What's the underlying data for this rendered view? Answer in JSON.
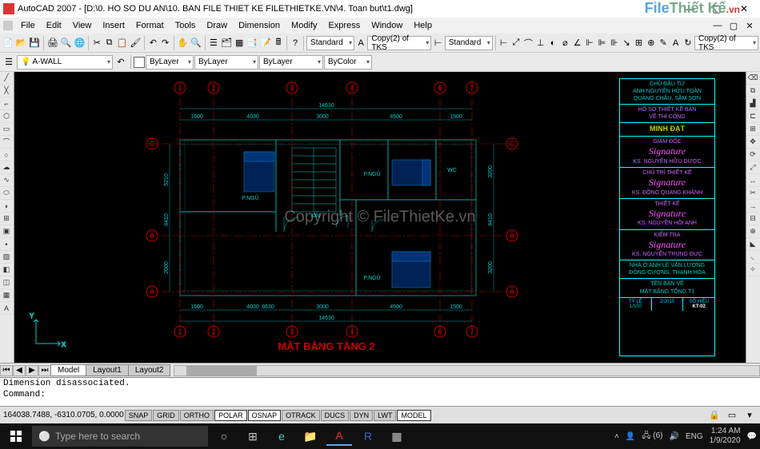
{
  "titlebar": {
    "title": "AutoCAD 2007 - [D:\\0. HO SO DU AN\\10. BAN FILE THIET KE FILETHIETKE.VN\\4. Toan but\\t1.dwg]"
  },
  "menubar": {
    "items": [
      "File",
      "Edit",
      "View",
      "Insert",
      "Format",
      "Tools",
      "Draw",
      "Dimension",
      "Modify",
      "Express",
      "Window",
      "Help"
    ]
  },
  "toolbar1": {
    "layer": "A-WALL",
    "linetype": "ByLayer",
    "lineweight": "ByLayer",
    "colorlabel": "ByColor"
  },
  "toolbar2": {
    "dd1": "Standard",
    "dd2": "Copy(2) of TKS",
    "dd3": "Standard",
    "dd4": "Copy(2) of TKS"
  },
  "tabs": {
    "model": "Model",
    "layout1": "Layout1",
    "layout2": "Layout2"
  },
  "command": {
    "line1": "Dimension disassociated.",
    "line2": "Command:"
  },
  "statusbar": {
    "coords": "164038.7488, -6310.0705, 0.0000",
    "toggles": [
      "SNAP",
      "GRID",
      "ORTHO",
      "POLAR",
      "OSNAP",
      "OTRACK",
      "DUCS",
      "DYN",
      "LWT",
      "MODEL"
    ]
  },
  "taskbar": {
    "search_placeholder": "Type here to search",
    "time": "1:24 AM",
    "date": "1/9/2020",
    "lang": "ENG",
    "net": "(6)"
  },
  "drawing": {
    "title": "MẶT BẰNG TẦNG 2",
    "grid_letters": [
      "A",
      "B",
      "C"
    ],
    "grid_numbers": [
      "1",
      "2",
      "3",
      "4",
      "6",
      "7"
    ],
    "dims_top_total": "14630",
    "dims_top": [
      "1600",
      "4030",
      "3000",
      "4500",
      "1500"
    ],
    "dims_bot_total": "14630",
    "dims_bot": [
      "1600",
      "4030",
      "3000",
      "4500",
      "1500"
    ],
    "dims_bot2": "8630",
    "dims_left": [
      "5210",
      "8410",
      "2000"
    ],
    "dims_right": [
      "3200",
      "8410",
      "3200"
    ],
    "rooms": {
      "pngu1": "P.NGỦ",
      "pngu2": "P.NGỦ",
      "pngu3": "P.NGỦ",
      "wc": "WC",
      "dn": "DN"
    }
  },
  "titleblock": {
    "owner_title": "CHỦ ĐẦU TƯ",
    "owner1": "ANH NGUYỄN HỮU TOÀN",
    "owner2": "QUẢNG CHÂU, SẦM SƠN",
    "doc_title1": "HỒ SƠ THIẾT KẾ BẢN",
    "doc_title2": "VẼ THI CÔNG",
    "company": "MINH ĐẠT",
    "role1": "GIÁM ĐỐC",
    "name1": "KS. NGUYỄN HỮU DƯỢC",
    "role2": "CHỦ TRÌ THIẾT KẾ",
    "name2": "KS. ĐỒNG QUANG KHÁNH",
    "role3": "THIẾT KẾ",
    "name3": "KS. NGUYỄN HỒI ANH",
    "role4": "KIỂM TRA",
    "name4": "KS. NGUYỄN TRUNG ĐỨC",
    "proj1": "NHÀ Ở ANH LÊ VĂN LƯỢNG",
    "proj2": "ĐÔNG CƯƠNG, THANH HÓA",
    "sheet_lbl": "TÊN BẢN VẼ",
    "sheet_t1": "MẶT BẰNG TỔNG T1",
    "scale_lbl": "TỶ LỆ",
    "scale": "1/100",
    "num_lbl": "SỐ HIỆU",
    "num": "KT-02",
    "date": "2/2015"
  },
  "watermark": {
    "brand1": "File",
    "brand2": "Thiết Kế",
    "brand3": ".vn",
    "copyright": "Copyright © FileThietKe.vn"
  }
}
